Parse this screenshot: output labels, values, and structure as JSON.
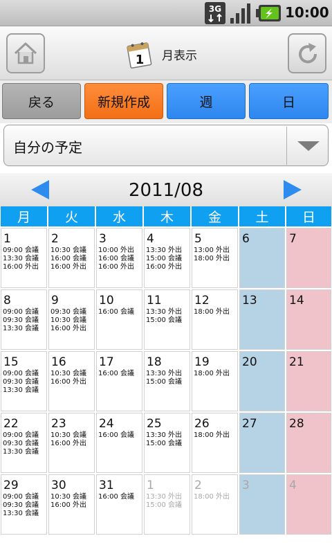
{
  "status_bar": {
    "network": "3G",
    "time": "10:00",
    "icons": [
      "3g-data-icon",
      "signal-icon",
      "battery-charging-icon"
    ]
  },
  "title_bar": {
    "title": "月表示",
    "calendar_icon_day": "1",
    "icons": [
      "home-icon",
      "calendar-icon",
      "refresh-icon"
    ]
  },
  "actions": {
    "back": "戻る",
    "new": "新規作成",
    "week": "週",
    "day": "日"
  },
  "colors": {
    "back": "#a8a8a8",
    "new": "#f7782a",
    "week_day": "#3a93f5",
    "weekday_header": "#10a0f2",
    "saturday": "#b6d3e6",
    "sunday": "#f0c3cb",
    "nav_arrow": "#2f8cef"
  },
  "dropdown": {
    "selected": "自分の予定"
  },
  "month": {
    "title": "2011/08"
  },
  "weekdays": [
    "月",
    "火",
    "水",
    "木",
    "金",
    "土",
    "日"
  ],
  "weeks": [
    [
      {
        "day": "1",
        "events": [
          "09:00 会議",
          "13:30 会議",
          "16:00 外出"
        ]
      },
      {
        "day": "2",
        "events": [
          "10:30 会議",
          "16:00 会議",
          "16:00 外出"
        ]
      },
      {
        "day": "3",
        "events": [
          "10:00 外出",
          "16:00 会議",
          "16:00 外出"
        ]
      },
      {
        "day": "4",
        "events": [
          "13:30 外出",
          "15:00 会議",
          "16:00 外出"
        ]
      },
      {
        "day": "5",
        "events": [
          "13:00 外出",
          "18:00 外出"
        ]
      },
      {
        "day": "6",
        "events": []
      },
      {
        "day": "7",
        "events": []
      }
    ],
    [
      {
        "day": "8",
        "events": [
          "09:00 会議",
          "09:30 会議",
          "13:30 会議"
        ]
      },
      {
        "day": "9",
        "events": [
          "09:30 会議",
          "10:30 会議",
          "16:00 外出"
        ]
      },
      {
        "day": "10",
        "events": [
          "16:00 会議"
        ]
      },
      {
        "day": "11",
        "events": [
          "13:30 外出",
          "15:00 会議"
        ]
      },
      {
        "day": "12",
        "events": [
          "18:00 外出"
        ]
      },
      {
        "day": "13",
        "events": []
      },
      {
        "day": "14",
        "events": []
      }
    ],
    [
      {
        "day": "15",
        "events": [
          "09:00 会議",
          "09:30 会議",
          "13:30 会議"
        ]
      },
      {
        "day": "16",
        "events": [
          "10:30 会議",
          "16:00 外出"
        ]
      },
      {
        "day": "17",
        "events": [
          "16:00 会議"
        ]
      },
      {
        "day": "18",
        "events": [
          "13:30 外出",
          "15:00 会議"
        ]
      },
      {
        "day": "19",
        "events": [
          "18:00 外出"
        ]
      },
      {
        "day": "20",
        "events": []
      },
      {
        "day": "21",
        "events": []
      }
    ],
    [
      {
        "day": "22",
        "events": [
          "09:00 会議",
          "09:30 会議",
          "13:30 会議"
        ]
      },
      {
        "day": "23",
        "events": [
          "10:30 会議",
          "16:00 外出"
        ]
      },
      {
        "day": "24",
        "events": [
          "16:00 会議"
        ]
      },
      {
        "day": "25",
        "events": [
          "13:30 外出",
          "15:00 会議"
        ]
      },
      {
        "day": "26",
        "events": [
          "18:00 外出"
        ]
      },
      {
        "day": "27",
        "events": []
      },
      {
        "day": "28",
        "events": []
      }
    ],
    [
      {
        "day": "29",
        "events": [
          "09:00 会議",
          "09:30 会議",
          "13:30 会議"
        ]
      },
      {
        "day": "30",
        "events": [
          "10:30 会議",
          "16:00 外出"
        ]
      },
      {
        "day": "31",
        "events": [
          "16:00 会議"
        ]
      },
      {
        "day": "1",
        "events": [
          "13:30 外出",
          "15:00 会議"
        ],
        "other_month": true
      },
      {
        "day": "2",
        "events": [
          "18:00 外出"
        ],
        "other_month": true
      },
      {
        "day": "3",
        "events": [],
        "other_month": true
      },
      {
        "day": "4",
        "events": [],
        "other_month": true
      }
    ]
  ]
}
